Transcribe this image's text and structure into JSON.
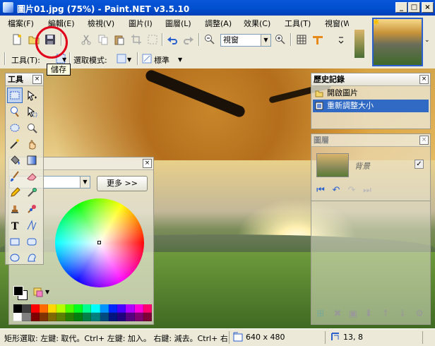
{
  "window": {
    "title": "圖片01.jpg (75%) - Paint.NET v3.5.10",
    "minimize": "_",
    "maximize": "□",
    "close": "×"
  },
  "menu": [
    "檔案(F)",
    "編輯(E)",
    "檢視(V)",
    "圖片(I)",
    "圖層(L)",
    "調整(A)",
    "效果(C)",
    "工具(T)",
    "視窗(W"
  ],
  "toolbar": {
    "zoom_value": "視窗",
    "save_tooltip": "儲存"
  },
  "toolbar2": {
    "tool_label": "工具(T):",
    "select_mode_label": "選取模式:",
    "standard_label": "標準"
  },
  "tools_panel": {
    "title": "工具",
    "close": "×",
    "tools": [
      "rectangle-select-icon",
      "move-selection-icon",
      "lasso-select-icon",
      "move-selection-alt-icon",
      "ellipse-select-icon",
      "zoom-icon",
      "magic-wand-icon",
      "pan-icon",
      "paint-bucket-icon",
      "gradient-icon",
      "paintbrush-icon",
      "eraser-icon",
      "pencil-icon",
      "color-picker-icon",
      "clone-stamp-icon",
      "recolor-icon",
      "text-icon",
      "line-curve-icon",
      "rectangle-icon",
      "rounded-rectangle-icon",
      "ellipse-icon",
      "freeform-shape-icon"
    ]
  },
  "colors_panel": {
    "close": "×",
    "more_button": "更多 >>",
    "primary_color": "#000000",
    "secondary_color": "#ffffff",
    "palette": [
      "#000000",
      "#404040",
      "#ff0000",
      "#ff6a00",
      "#ffd800",
      "#b6ff00",
      "#4cff00",
      "#00ff21",
      "#00ff90",
      "#00ffff",
      "#0094ff",
      "#0026ff",
      "#4800ff",
      "#b200ff",
      "#ff00dc",
      "#ff006e",
      "#ffffff",
      "#808080",
      "#7f0000",
      "#7f3300",
      "#7f6a00",
      "#5b7f00",
      "#267f00",
      "#007f0e",
      "#007f46",
      "#007f7f",
      "#004a7f",
      "#00137f",
      "#21007f",
      "#57007f",
      "#7f006e",
      "#7f0037"
    ]
  },
  "history_panel": {
    "title": "歷史記錄",
    "close": "×",
    "items": [
      {
        "label": "開啟圖片",
        "selected": false
      },
      {
        "label": "重新調整大小",
        "selected": true
      }
    ]
  },
  "layers_panel": {
    "title": "圖層",
    "close": "×",
    "layer_name": "背景",
    "layer_visible": "✓"
  },
  "status": {
    "hint": "矩形選取: 左鍵: 取代。Ctrl+ 左鍵: 加入。 右鍵: 減去。Ctrl+ 右",
    "image_size": "640 x 480",
    "cursor_pos": "13, 8"
  }
}
